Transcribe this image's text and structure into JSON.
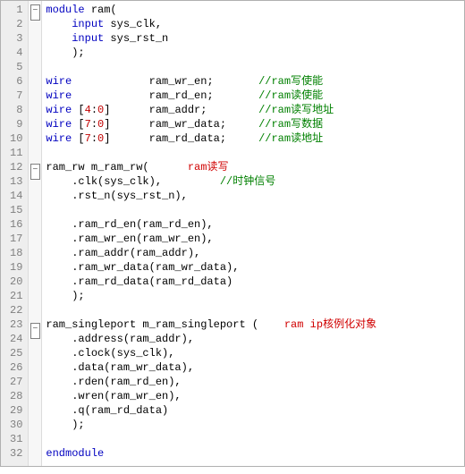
{
  "lines": [
    {
      "n": 1,
      "fold": "open",
      "segs": [
        {
          "c": "kw",
          "t": "module"
        },
        {
          "c": "txt",
          "t": " ram("
        }
      ]
    },
    {
      "n": 2,
      "fold": "",
      "segs": [
        {
          "c": "txt",
          "t": "    "
        },
        {
          "c": "kw",
          "t": "input"
        },
        {
          "c": "txt",
          "t": " sys_clk,"
        }
      ]
    },
    {
      "n": 3,
      "fold": "",
      "segs": [
        {
          "c": "txt",
          "t": "    "
        },
        {
          "c": "kw",
          "t": "input"
        },
        {
          "c": "txt",
          "t": " sys_rst_n"
        }
      ]
    },
    {
      "n": 4,
      "fold": "",
      "segs": [
        {
          "c": "txt",
          "t": "    );"
        }
      ]
    },
    {
      "n": 5,
      "fold": "",
      "segs": [
        {
          "c": "txt",
          "t": ""
        }
      ]
    },
    {
      "n": 6,
      "fold": "",
      "segs": [
        {
          "c": "kw",
          "t": "wire"
        },
        {
          "c": "txt",
          "t": "            ram_wr_en;       "
        },
        {
          "c": "cmt",
          "t": "//ram写使能"
        }
      ]
    },
    {
      "n": 7,
      "fold": "",
      "segs": [
        {
          "c": "kw",
          "t": "wire"
        },
        {
          "c": "txt",
          "t": "            ram_rd_en;       "
        },
        {
          "c": "cmt",
          "t": "//ram读使能"
        }
      ]
    },
    {
      "n": 8,
      "fold": "",
      "segs": [
        {
          "c": "kw",
          "t": "wire"
        },
        {
          "c": "txt",
          "t": " ["
        },
        {
          "c": "num",
          "t": "4"
        },
        {
          "c": "txt",
          "t": ":"
        },
        {
          "c": "num",
          "t": "0"
        },
        {
          "c": "txt",
          "t": "]      ram_addr;        "
        },
        {
          "c": "cmt",
          "t": "//ram读写地址"
        }
      ]
    },
    {
      "n": 9,
      "fold": "",
      "segs": [
        {
          "c": "kw",
          "t": "wire"
        },
        {
          "c": "txt",
          "t": " ["
        },
        {
          "c": "num",
          "t": "7"
        },
        {
          "c": "txt",
          "t": ":"
        },
        {
          "c": "num",
          "t": "0"
        },
        {
          "c": "txt",
          "t": "]      ram_wr_data;     "
        },
        {
          "c": "cmt",
          "t": "//ram写数据"
        }
      ]
    },
    {
      "n": 10,
      "fold": "",
      "segs": [
        {
          "c": "kw",
          "t": "wire"
        },
        {
          "c": "txt",
          "t": " ["
        },
        {
          "c": "num",
          "t": "7"
        },
        {
          "c": "txt",
          "t": ":"
        },
        {
          "c": "num",
          "t": "0"
        },
        {
          "c": "txt",
          "t": "]      ram_rd_data;     "
        },
        {
          "c": "cmt",
          "t": "//ram读地址"
        }
      ]
    },
    {
      "n": 11,
      "fold": "",
      "segs": [
        {
          "c": "txt",
          "t": ""
        }
      ]
    },
    {
      "n": 12,
      "fold": "open",
      "segs": [
        {
          "c": "txt",
          "t": "ram_rw m_ram_rw(      "
        },
        {
          "c": "ann",
          "t": "ram读写"
        }
      ]
    },
    {
      "n": 13,
      "fold": "",
      "segs": [
        {
          "c": "txt",
          "t": "    .clk(sys_clk),         "
        },
        {
          "c": "cmt",
          "t": "//时钟信号"
        }
      ]
    },
    {
      "n": 14,
      "fold": "",
      "segs": [
        {
          "c": "txt",
          "t": "    .rst_n(sys_rst_n),"
        }
      ]
    },
    {
      "n": 15,
      "fold": "",
      "segs": [
        {
          "c": "txt",
          "t": ""
        }
      ]
    },
    {
      "n": 16,
      "fold": "",
      "segs": [
        {
          "c": "txt",
          "t": "    .ram_rd_en(ram_rd_en),"
        }
      ]
    },
    {
      "n": 17,
      "fold": "",
      "segs": [
        {
          "c": "txt",
          "t": "    .ram_wr_en(ram_wr_en),"
        }
      ]
    },
    {
      "n": 18,
      "fold": "",
      "segs": [
        {
          "c": "txt",
          "t": "    .ram_addr(ram_addr),"
        }
      ]
    },
    {
      "n": 19,
      "fold": "",
      "segs": [
        {
          "c": "txt",
          "t": "    .ram_wr_data(ram_wr_data),"
        }
      ]
    },
    {
      "n": 20,
      "fold": "",
      "segs": [
        {
          "c": "txt",
          "t": "    .ram_rd_data(ram_rd_data)"
        }
      ]
    },
    {
      "n": 21,
      "fold": "",
      "segs": [
        {
          "c": "txt",
          "t": "    );"
        }
      ]
    },
    {
      "n": 22,
      "fold": "",
      "segs": [
        {
          "c": "txt",
          "t": ""
        }
      ]
    },
    {
      "n": 23,
      "fold": "open",
      "segs": [
        {
          "c": "txt",
          "t": "ram_singleport m_ram_singleport (    "
        },
        {
          "c": "ann",
          "t": "ram ip核例化对象"
        }
      ]
    },
    {
      "n": 24,
      "fold": "",
      "segs": [
        {
          "c": "txt",
          "t": "    .address(ram_addr),"
        }
      ]
    },
    {
      "n": 25,
      "fold": "",
      "segs": [
        {
          "c": "txt",
          "t": "    .clock(sys_clk),"
        }
      ]
    },
    {
      "n": 26,
      "fold": "",
      "segs": [
        {
          "c": "txt",
          "t": "    .data(ram_wr_data),"
        }
      ]
    },
    {
      "n": 27,
      "fold": "",
      "segs": [
        {
          "c": "txt",
          "t": "    .rden(ram_rd_en),"
        }
      ]
    },
    {
      "n": 28,
      "fold": "",
      "segs": [
        {
          "c": "txt",
          "t": "    .wren(ram_wr_en),"
        }
      ]
    },
    {
      "n": 29,
      "fold": "",
      "segs": [
        {
          "c": "txt",
          "t": "    .q(ram_rd_data)"
        }
      ]
    },
    {
      "n": 30,
      "fold": "",
      "segs": [
        {
          "c": "txt",
          "t": "    );"
        }
      ]
    },
    {
      "n": 31,
      "fold": "",
      "segs": [
        {
          "c": "txt",
          "t": ""
        }
      ]
    },
    {
      "n": 32,
      "fold": "",
      "segs": [
        {
          "c": "kw",
          "t": "endmodule"
        }
      ]
    }
  ]
}
